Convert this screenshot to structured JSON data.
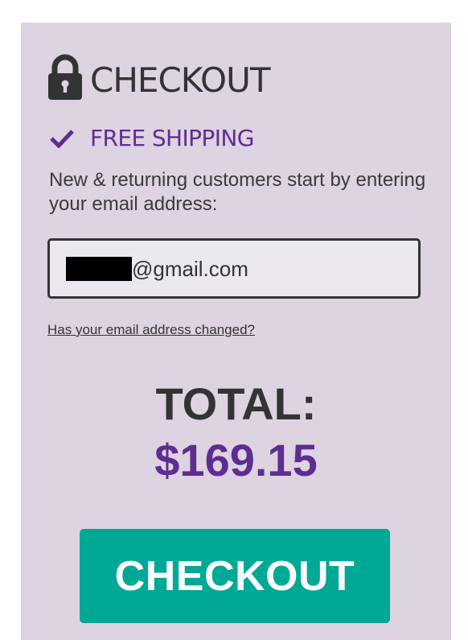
{
  "header": {
    "title": "CHECKOUT",
    "icon": "lock-icon"
  },
  "shipping": {
    "label": "FREE SHIPPING",
    "icon": "checkmark-icon"
  },
  "instructions": "New & returning customers start by entering your email address:",
  "email_field": {
    "value_visible": "@gmail.com",
    "redacted_prefix": true
  },
  "email_changed_link": "Has your email address changed?",
  "total": {
    "label": "TOTAL:",
    "amount": "$169.15"
  },
  "checkout_button": {
    "label": "CHECKOUT"
  },
  "colors": {
    "panel_background": "#ddd3e1",
    "accent_purple": "#5e2d91",
    "button_teal": "#00a895",
    "text_dark": "#333333",
    "input_background": "#ede7f0"
  }
}
